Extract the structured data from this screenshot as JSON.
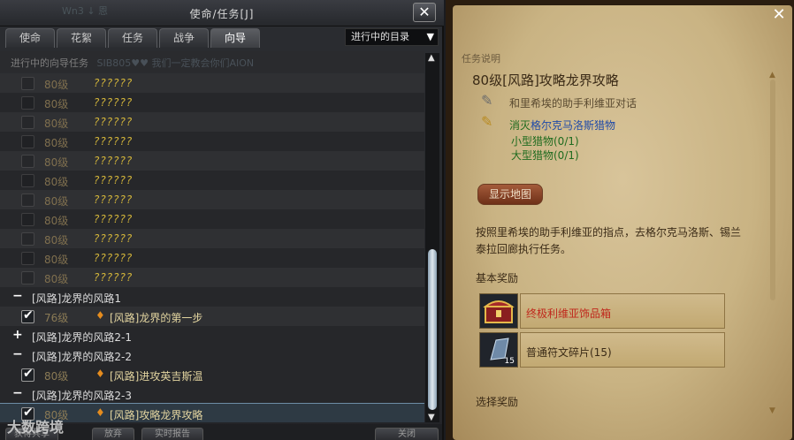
{
  "window": {
    "title": "使命/任务[J]",
    "close_symbol": "✕",
    "title_ghost": "Wn3 ↓ 恩"
  },
  "tabs": [
    "使命",
    "花絮",
    "任务",
    "战争",
    "向导"
  ],
  "dropdown": {
    "value": "进行中的目录",
    "arrow": "▼"
  },
  "list_header": {
    "label": "进行中的向导任务",
    "ghost": "SIB805♥♥ 我们一定教会你们AION"
  },
  "rows": [
    {
      "type": "quest",
      "level": "80级",
      "name": "??????",
      "checked": false,
      "muted": true
    },
    {
      "type": "quest",
      "level": "80级",
      "name": "??????",
      "checked": false,
      "muted": true
    },
    {
      "type": "quest",
      "level": "80级",
      "name": "??????",
      "checked": false,
      "muted": true
    },
    {
      "type": "quest",
      "level": "80级",
      "name": "??????",
      "checked": false,
      "muted": true
    },
    {
      "type": "quest",
      "level": "80级",
      "name": "??????",
      "checked": false,
      "muted": true
    },
    {
      "type": "quest",
      "level": "80级",
      "name": "??????",
      "checked": false,
      "muted": true
    },
    {
      "type": "quest",
      "level": "80级",
      "name": "??????",
      "checked": false,
      "muted": true
    },
    {
      "type": "quest",
      "level": "80级",
      "name": "??????",
      "checked": false,
      "muted": true
    },
    {
      "type": "quest",
      "level": "80级",
      "name": "??????",
      "checked": false,
      "muted": true
    },
    {
      "type": "quest",
      "level": "80级",
      "name": "??????",
      "checked": false,
      "muted": true
    },
    {
      "type": "quest",
      "level": "80级",
      "name": "??????",
      "checked": false,
      "muted": true
    },
    {
      "type": "group",
      "sign": "−",
      "name": "[风路]龙界的风路1"
    },
    {
      "type": "quest",
      "level": "76级",
      "name": "[风路]龙界的第一步",
      "checked": true,
      "muted": false
    },
    {
      "type": "group",
      "sign": "+",
      "name": "[风路]龙界的风路2-1"
    },
    {
      "type": "group",
      "sign": "−",
      "name": "[风路]龙界的风路2-2"
    },
    {
      "type": "quest",
      "level": "80级",
      "name": "[风路]进攻英吉斯温",
      "checked": true,
      "muted": false
    },
    {
      "type": "group",
      "sign": "−",
      "name": "[风路]龙界的风路2-3"
    },
    {
      "type": "quest",
      "level": "80级",
      "name": "[风路]攻略龙界攻略",
      "checked": true,
      "muted": false,
      "selected": true
    }
  ],
  "scrollbar": {
    "up": "▲",
    "down": "▼"
  },
  "bottom_buttons": [
    "获得共享",
    "放弃",
    "实时报告",
    "关闭"
  ],
  "watermark": "大数跨境",
  "detail": {
    "close_symbol": "✕",
    "section_label": "任务说明",
    "title": "80级[风路]攻略龙界攻略",
    "step1": "和里希埃的助手利维亚对话",
    "step2_prefix": "消灭",
    "step2_target": "格尔克马洛斯猎物",
    "sub1": "小型猎物(0/1)",
    "sub2": "大型猎物(0/1)",
    "map_button": "显示地图",
    "description": "按照里希埃的助手利维亚的指点，去格尔克马洛斯、锡兰泰拉回廊执行任务。",
    "basic_reward_label": "基本奖励",
    "rewards": [
      {
        "name": "终极利维亚饰品箱",
        "color": "#c0281c"
      },
      {
        "name": "普通符文碎片(15)",
        "color": "#3a2a16",
        "count": "15"
      }
    ],
    "choice_reward_label": "选择奖励",
    "scroll_up": "▲",
    "scroll_down": "▼"
  },
  "colors": {
    "accent_gold": "#d2b43a",
    "level_text": "#8a7a55",
    "step_green": "#1f6b1f",
    "step_blue": "#1f4aa8",
    "reward_red": "#c0281c"
  }
}
